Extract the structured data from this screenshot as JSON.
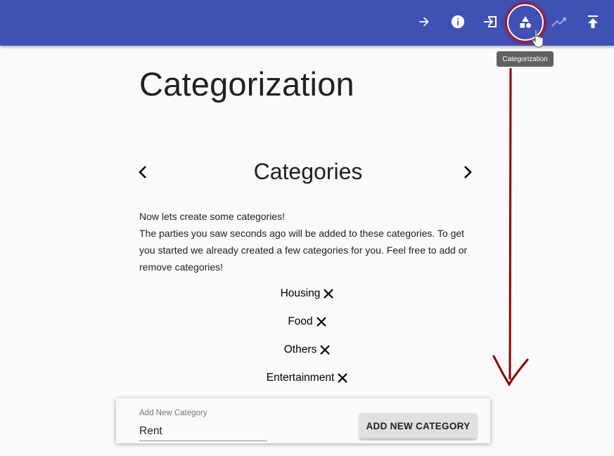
{
  "appbar": {
    "color": "#3f51b5",
    "buttons": [
      {
        "icon": "arrow-right-icon"
      },
      {
        "icon": "info-icon"
      },
      {
        "icon": "import-icon"
      },
      {
        "icon": "category-shapes-icon",
        "active": true
      },
      {
        "icon": "trending-up-icon"
      },
      {
        "icon": "upload-icon"
      }
    ],
    "tooltip": "Categorization"
  },
  "page": {
    "title": "Categorization"
  },
  "section": {
    "title": "Categories",
    "prev_icon": "chevron-left-icon",
    "next_icon": "chevron-right-icon",
    "intro_line1": "Now lets create some categories!",
    "intro_line2": "The parties you saw seconds ago will be added to these categories. To get you started we already created a few categories for you. Feel free to add or remove categories!"
  },
  "categories": [
    {
      "label": "Housing"
    },
    {
      "label": "Food"
    },
    {
      "label": "Others"
    },
    {
      "label": "Entertainment"
    }
  ],
  "form": {
    "field_label": "Add New Category",
    "field_value": "Rent",
    "button_label": "ADD NEW CATEGORY"
  }
}
